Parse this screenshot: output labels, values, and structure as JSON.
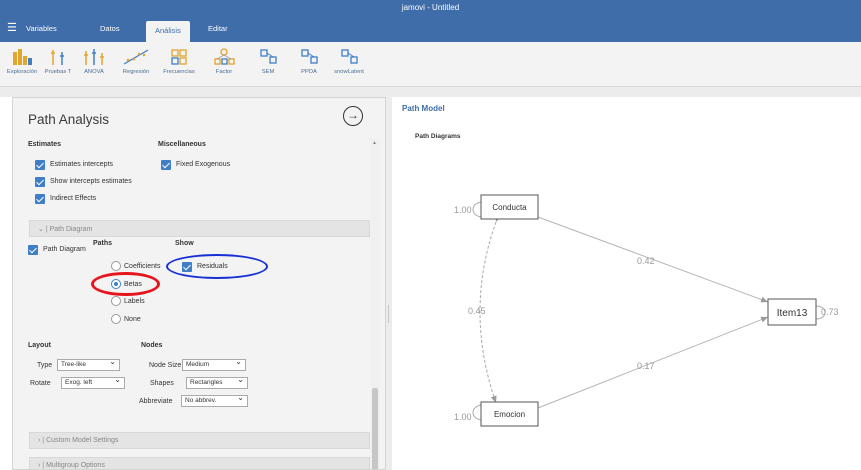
{
  "app": {
    "title": "jamovi - Untitled"
  },
  "menu": {
    "tabs": [
      {
        "label": "Variables",
        "active": false
      },
      {
        "label": "Datos",
        "active": false
      },
      {
        "label": "Análisis",
        "active": true
      },
      {
        "label": "Editar",
        "active": false
      }
    ]
  },
  "ribbon": {
    "items": [
      {
        "label": "Exploración",
        "icon": "exploration-icon"
      },
      {
        "label": "Pruebas T",
        "icon": "t-tests-icon"
      },
      {
        "label": "ANOVA",
        "icon": "anova-icon"
      },
      {
        "label": "Regresión",
        "icon": "regression-icon"
      },
      {
        "label": "Frecuencias",
        "icon": "frequencies-icon"
      },
      {
        "label": "Factor",
        "icon": "factor-icon"
      },
      {
        "label": "SEM",
        "icon": "sem-icon"
      },
      {
        "label": "PPDA",
        "icon": "ppda-icon"
      },
      {
        "label": "snowLatent",
        "icon": "snowlatent-icon"
      }
    ]
  },
  "options": {
    "title": "Path Analysis",
    "estimates": {
      "heading": "Estimates",
      "items": [
        {
          "label": "Estimates intercepts",
          "checked": true
        },
        {
          "label": "Show intercepts estimates",
          "checked": true
        },
        {
          "label": "Indirect Effects",
          "checked": true
        }
      ]
    },
    "misc": {
      "heading": "Miscellaneous",
      "items": [
        {
          "label": "Fixed Exogenous",
          "checked": true
        }
      ]
    },
    "path_diagram_section": "Path Diagram",
    "path_diagram_checkbox": "Path Diagram",
    "paths": {
      "heading": "Paths",
      "options": [
        "Coefficients",
        "Betas",
        "Labels",
        "None"
      ],
      "selected": "Betas"
    },
    "show": {
      "heading": "Show",
      "residuals": "Residuals",
      "residuals_checked": true
    },
    "layout": {
      "heading": "Layout",
      "type_label": "Type",
      "type_value": "Tree-like",
      "rotate_label": "Rotate",
      "rotate_value": "Exog. left"
    },
    "nodes": {
      "heading": "Nodes",
      "size_label": "Node Size",
      "size_value": "Medium",
      "shapes_label": "Shapes",
      "shapes_value": "Rectangles",
      "abbreviate_label": "Abbreviate",
      "abbreviate_value": "No abbrev."
    },
    "sections_collapsed": [
      "Custom Model Settings",
      "Multigroup Options"
    ],
    "annotation_colors": {
      "red": "#e8141c",
      "blue": "#1630d6"
    }
  },
  "results": {
    "heading": "Path Model",
    "subheading": "Path Diagrams",
    "diagram": {
      "nodes": [
        {
          "label": "Conducta",
          "residual": "1.00"
        },
        {
          "label": "Emocion",
          "residual": "1.00"
        },
        {
          "label": "Item13",
          "residual": "0.73"
        }
      ],
      "paths": [
        {
          "from": "Conducta",
          "to": "Item13",
          "value": "0.42"
        },
        {
          "from": "Emocion",
          "to": "Item13",
          "value": "0.17"
        }
      ],
      "covariance": {
        "between": [
          "Conducta",
          "Emocion"
        ],
        "value": "0.45"
      }
    }
  }
}
